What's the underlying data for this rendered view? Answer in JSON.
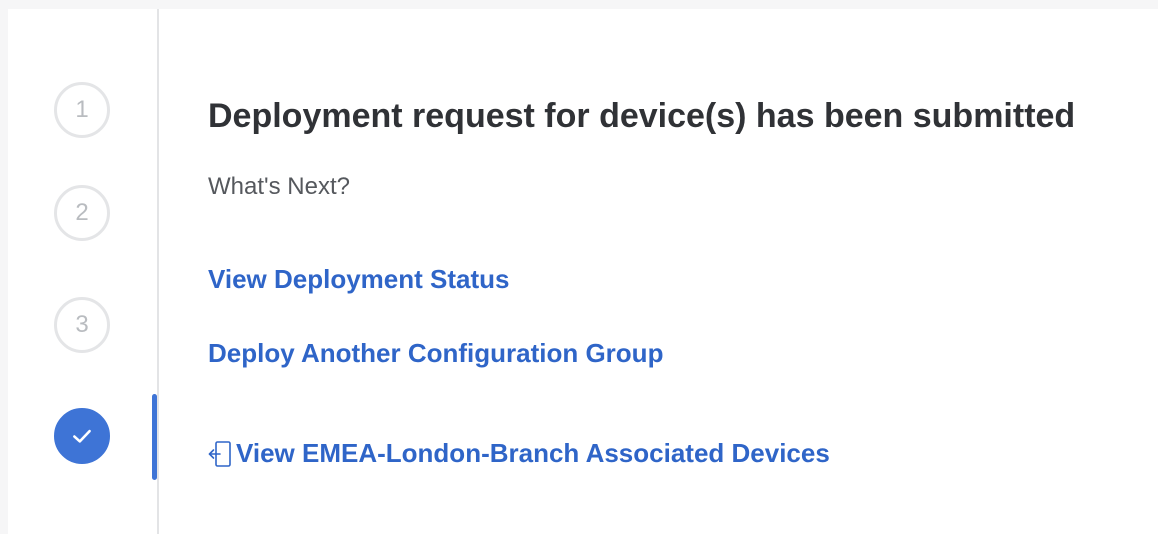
{
  "stepper": {
    "steps": [
      {
        "label": "1",
        "state": "pending"
      },
      {
        "label": "2",
        "state": "pending"
      },
      {
        "label": "3",
        "state": "pending"
      },
      {
        "label": "",
        "state": "complete",
        "icon": "check-icon"
      }
    ],
    "active_step": 4,
    "colors": {
      "accent": "#3e74d6",
      "pending_border": "#e4e5e7",
      "pending_text": "#b9bcc0"
    }
  },
  "main": {
    "title": "Deployment request for device(s) has been submitted",
    "subtitle": "What's Next?",
    "links": {
      "view_status": "View Deployment Status",
      "deploy_another": "Deploy Another Configuration Group",
      "view_devices": "View EMEA-London-Branch Associated Devices",
      "view_devices_icon": "external-open-icon"
    },
    "colors": {
      "link": "#2f65c8",
      "title": "#303236",
      "subtitle": "#55585d"
    }
  }
}
